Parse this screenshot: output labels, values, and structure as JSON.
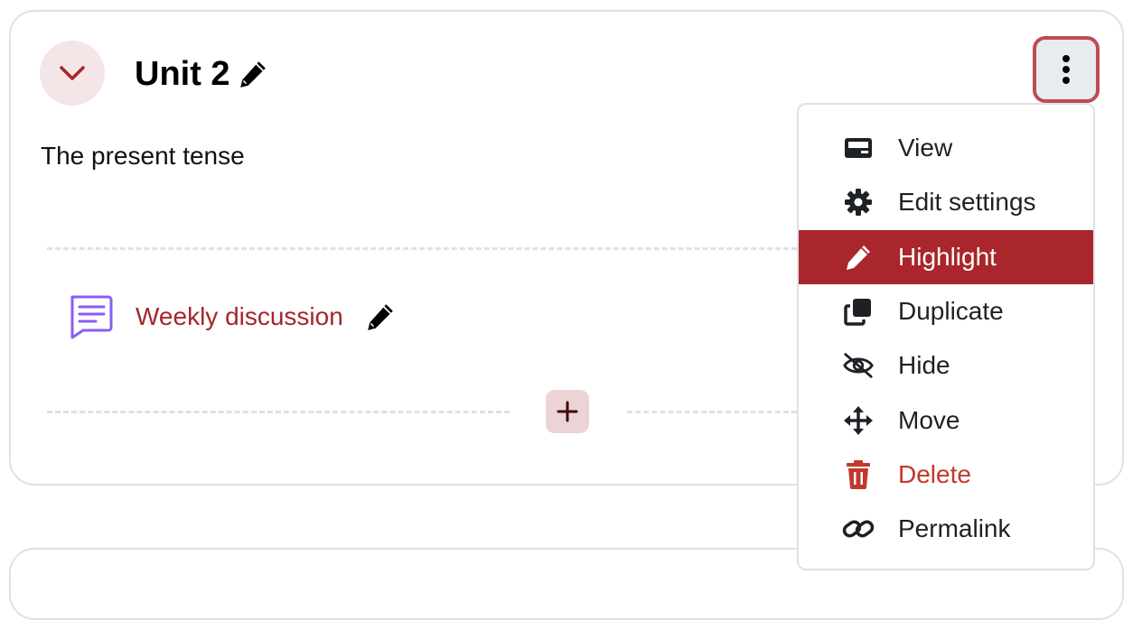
{
  "section": {
    "title": "Unit 2",
    "summary": "The present tense"
  },
  "activity": {
    "name": "Weekly discussion",
    "icon": "forum-icon"
  },
  "colors": {
    "accent": "#a8262c",
    "danger": "#c0392b",
    "forum_icon": "#8a5cf6",
    "kebab_border": "#c04a57"
  },
  "menu": {
    "items": [
      {
        "label": "View",
        "icon": "view-icon"
      },
      {
        "label": "Edit settings",
        "icon": "gear-icon"
      },
      {
        "label": "Highlight",
        "icon": "pencil-icon",
        "active": true
      },
      {
        "label": "Duplicate",
        "icon": "copy-icon"
      },
      {
        "label": "Hide",
        "icon": "eye-slash-icon"
      },
      {
        "label": "Move",
        "icon": "move-arrows-icon"
      },
      {
        "label": "Delete",
        "icon": "trash-icon",
        "danger": true
      },
      {
        "label": "Permalink",
        "icon": "link-icon"
      }
    ]
  }
}
